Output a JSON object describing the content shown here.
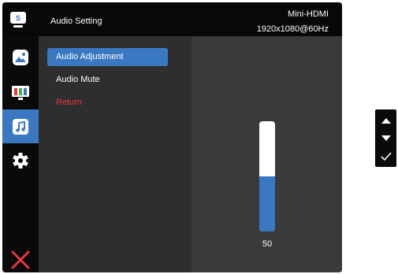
{
  "header": {
    "title": "Audio Setting",
    "source": "Mini-HDMI",
    "resolution": "1920x1080@60Hz",
    "logo_letter": "S"
  },
  "sidebar": {
    "items": [
      {
        "icon": "image-icon",
        "active": false
      },
      {
        "icon": "color-bars-icon",
        "active": false
      },
      {
        "icon": "music-note-icon",
        "active": true
      },
      {
        "icon": "gear-icon",
        "active": false
      },
      {
        "icon": "close-icon",
        "active": false
      }
    ]
  },
  "menu": {
    "items": [
      {
        "label": "Audio Adjustment",
        "selected": true
      },
      {
        "label": "Audio Mute",
        "selected": false
      },
      {
        "label": "Return",
        "selected": false
      }
    ]
  },
  "volume": {
    "value": 50,
    "value_label": "50",
    "max": 100
  },
  "colors": {
    "accent": "#3a78c2",
    "return_text": "#e8383c",
    "close_icon": "#e8383c",
    "header_bg": "#080808",
    "sidebar_bg": "#0a0a0a"
  },
  "nav_keys": [
    "up-arrow-icon",
    "down-arrow-icon",
    "check-icon"
  ]
}
